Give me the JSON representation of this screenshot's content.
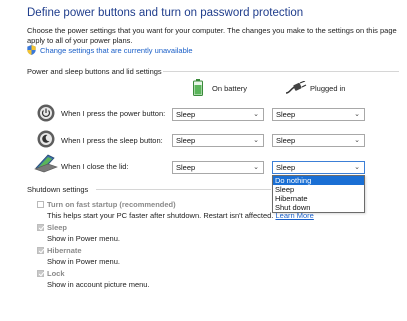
{
  "header": {
    "title": "Define power buttons and turn on password protection",
    "description": "Choose the power settings that you want for your computer. The changes you make to the settings on this page apply to all of your power plans.",
    "change_link": "Change settings that are currently unavailable"
  },
  "power_section": {
    "label": "Power and sleep buttons and lid settings",
    "col_battery": "On battery",
    "col_plugged": "Plugged in",
    "rows": [
      {
        "label": "When I press the power button:",
        "icon": "power-button-icon",
        "battery": "Sleep",
        "plugged": "Sleep"
      },
      {
        "label": "When I press the sleep button:",
        "icon": "sleep-button-icon",
        "battery": "Sleep",
        "plugged": "Sleep"
      },
      {
        "label": "When I close the lid:",
        "icon": "laptop-lid-icon",
        "battery": "Sleep",
        "plugged": "Sleep"
      }
    ],
    "dropdown_options": [
      "Do nothing",
      "Sleep",
      "Hibernate",
      "Shut down"
    ],
    "dropdown_highlighted": "Do nothing"
  },
  "shutdown_section": {
    "label": "Shutdown settings",
    "options": [
      {
        "title": "Turn on fast startup (recommended)",
        "checked": false,
        "desc": "This helps start your PC faster after shutdown. Restart isn't affected.",
        "link": "Learn More"
      },
      {
        "title": "Sleep",
        "checked": true,
        "desc": "Show in Power menu."
      },
      {
        "title": "Hibernate",
        "checked": true,
        "desc": "Show in Power menu."
      },
      {
        "title": "Lock",
        "checked": true,
        "desc": "Show in account picture menu."
      }
    ]
  },
  "colors": {
    "title": "#1f3d8c",
    "link": "#1a5fc8",
    "highlight": "#1a6fd4"
  }
}
